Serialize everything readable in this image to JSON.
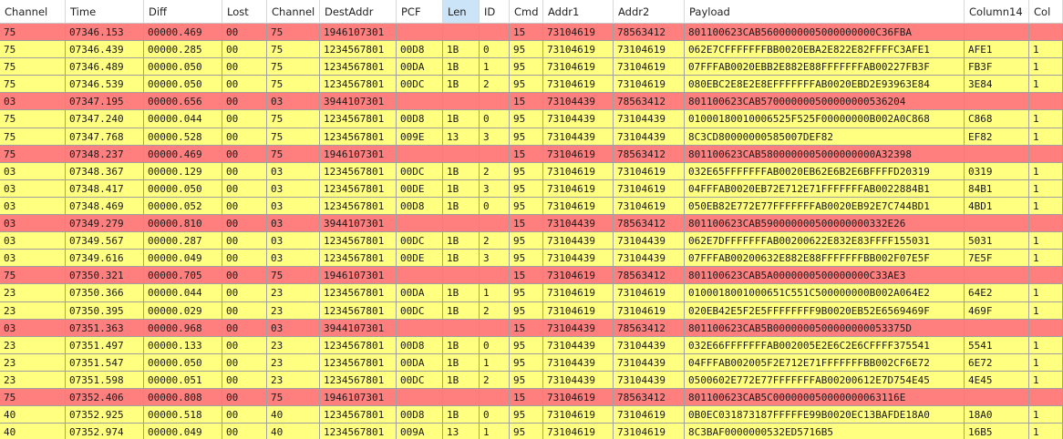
{
  "table": {
    "sorted_column": "Len",
    "columns": [
      "Channel",
      "Time",
      "Diff",
      "Lost",
      "Channel",
      "DestAddr",
      "PCF",
      "Len",
      "ID",
      "Cmd",
      "Addr1",
      "Addr2",
      "Payload",
      "Column14",
      "Col"
    ],
    "rows": [
      {
        "kind": "sep",
        "cells": [
          "75",
          "07346.153",
          "00000.469",
          "00",
          "75",
          "1946107301",
          "",
          "",
          "",
          "15",
          "73104619",
          "78563412",
          "801100623CAB5600000005000000000C36FBA",
          "",
          ""
        ]
      },
      {
        "kind": "msg",
        "cells": [
          "75",
          "07346.439",
          "00000.285",
          "00",
          "75",
          "1234567801",
          "00D8",
          "1B",
          "0",
          "95",
          "73104619",
          "73104619",
          "062E7CFFFFFFFBB0020EBA2E822E82FFFFC3AFE1",
          "AFE1",
          "1"
        ]
      },
      {
        "kind": "msg",
        "cells": [
          "75",
          "07346.489",
          "00000.050",
          "00",
          "75",
          "1234567801",
          "00DA",
          "1B",
          "1",
          "95",
          "73104619",
          "73104619",
          "07FFFAB0020EBB2E882E88FFFFFFFAB00227FB3F",
          "FB3F",
          "1"
        ]
      },
      {
        "kind": "msg",
        "cells": [
          "75",
          "07346.539",
          "00000.050",
          "00",
          "75",
          "1234567801",
          "00DC",
          "1B",
          "2",
          "95",
          "73104619",
          "73104619",
          "080EBC2E8E2E8EFFFFFFFAB0020EBD2E93963E84",
          "3E84",
          "1"
        ]
      },
      {
        "kind": "sep",
        "cells": [
          "03",
          "07347.195",
          "00000.656",
          "00",
          "03",
          "3944107301",
          "",
          "",
          "",
          "15",
          "73104439",
          "78563412",
          "801100623CAB570000000500000000536204",
          "",
          ""
        ]
      },
      {
        "kind": "msg",
        "cells": [
          "75",
          "07347.240",
          "00000.044",
          "00",
          "75",
          "1234567801",
          "00D8",
          "1B",
          "0",
          "95",
          "73104439",
          "73104439",
          "01000180010006525F525F00000000B002A0C868",
          "C868",
          "1"
        ]
      },
      {
        "kind": "msg",
        "cells": [
          "75",
          "07347.768",
          "00000.528",
          "00",
          "75",
          "1234567801",
          "009E",
          "13",
          "3",
          "95",
          "73104439",
          "73104439",
          "8C3CD80000000585007DEF82",
          "EF82",
          "1"
        ]
      },
      {
        "kind": "sep",
        "cells": [
          "75",
          "07348.237",
          "00000.469",
          "00",
          "75",
          "1946107301",
          "",
          "",
          "",
          "15",
          "73104619",
          "78563412",
          "801100623CAB5800000005000000000A32398",
          "",
          ""
        ]
      },
      {
        "kind": "msg",
        "cells": [
          "03",
          "07348.367",
          "00000.129",
          "00",
          "03",
          "1234567801",
          "00DC",
          "1B",
          "2",
          "95",
          "73104619",
          "73104619",
          "032E65FFFFFFFAB0020EB62E6B2E6BFFFFD20319",
          "0319",
          "1"
        ]
      },
      {
        "kind": "msg",
        "cells": [
          "03",
          "07348.417",
          "00000.050",
          "00",
          "03",
          "1234567801",
          "00DE",
          "1B",
          "3",
          "95",
          "73104619",
          "73104619",
          "04FFFAB0020EB72E712E71FFFFFFFAB0022884B1",
          "84B1",
          "1"
        ]
      },
      {
        "kind": "msg",
        "cells": [
          "03",
          "07348.469",
          "00000.052",
          "00",
          "03",
          "1234567801",
          "00D8",
          "1B",
          "0",
          "95",
          "73104619",
          "73104619",
          "050EB82E772E77FFFFFFFAB0020EB92E7C744BD1",
          "4BD1",
          "1"
        ]
      },
      {
        "kind": "sep",
        "cells": [
          "03",
          "07349.279",
          "00000.810",
          "00",
          "03",
          "3944107301",
          "",
          "",
          "",
          "15",
          "73104439",
          "78563412",
          "801100623CAB590000000500000000332E26",
          "",
          ""
        ]
      },
      {
        "kind": "msg",
        "cells": [
          "03",
          "07349.567",
          "00000.287",
          "00",
          "03",
          "1234567801",
          "00DC",
          "1B",
          "2",
          "95",
          "73104439",
          "73104439",
          "062E7DFFFFFFFAB00200622E832E83FFFF155031",
          "5031",
          "1"
        ]
      },
      {
        "kind": "msg",
        "cells": [
          "03",
          "07349.616",
          "00000.049",
          "00",
          "03",
          "1234567801",
          "00DE",
          "1B",
          "3",
          "95",
          "73104439",
          "73104439",
          "07FFFAB00200632E882E88FFFFFFFBB002F07E5F",
          "7E5F",
          "1"
        ]
      },
      {
        "kind": "sep",
        "cells": [
          "75",
          "07350.321",
          "00000.705",
          "00",
          "75",
          "1946107301",
          "",
          "",
          "",
          "15",
          "73104619",
          "78563412",
          "801100623CAB5A0000000500000000C33AE3",
          "",
          ""
        ]
      },
      {
        "kind": "msg",
        "cells": [
          "23",
          "07350.366",
          "00000.044",
          "00",
          "23",
          "1234567801",
          "00DA",
          "1B",
          "1",
          "95",
          "73104619",
          "73104619",
          "0100018001000651C551C500000000B002A064E2",
          "64E2",
          "1"
        ]
      },
      {
        "kind": "msg",
        "cells": [
          "23",
          "07350.395",
          "00000.029",
          "00",
          "23",
          "1234567801",
          "00DC",
          "1B",
          "2",
          "95",
          "73104619",
          "73104619",
          "020EB42E5F2E5FFFFFFFF9B0020EB52E6569469F",
          "469F",
          "1"
        ]
      },
      {
        "kind": "sep",
        "cells": [
          "03",
          "07351.363",
          "00000.968",
          "00",
          "03",
          "3944107301",
          "",
          "",
          "",
          "15",
          "73104439",
          "78563412",
          "801100623CAB5B0000000500000000053375D",
          "",
          ""
        ]
      },
      {
        "kind": "msg",
        "cells": [
          "23",
          "07351.497",
          "00000.133",
          "00",
          "23",
          "1234567801",
          "00D8",
          "1B",
          "0",
          "95",
          "73104439",
          "73104439",
          "032E66FFFFFFFAB002005E2E6C2E6CFFFF375541",
          "5541",
          "1"
        ]
      },
      {
        "kind": "msg",
        "cells": [
          "23",
          "07351.547",
          "00000.050",
          "00",
          "23",
          "1234567801",
          "00DA",
          "1B",
          "1",
          "95",
          "73104439",
          "73104439",
          "04FFFAB002005F2E712E71FFFFFFFBB002CF6E72",
          "6E72",
          "1"
        ]
      },
      {
        "kind": "msg",
        "cells": [
          "23",
          "07351.598",
          "00000.051",
          "00",
          "23",
          "1234567801",
          "00DC",
          "1B",
          "2",
          "95",
          "73104439",
          "73104439",
          "0500602E772E77FFFFFFFAB00200612E7D754E45",
          "4E45",
          "1"
        ]
      },
      {
        "kind": "sep",
        "cells": [
          "75",
          "07352.406",
          "00000.808",
          "00",
          "75",
          "1946107301",
          "",
          "",
          "",
          "15",
          "73104619",
          "78563412",
          "801100623CAB5C000000050000000063116E",
          "",
          ""
        ]
      },
      {
        "kind": "msg",
        "cells": [
          "40",
          "07352.925",
          "00000.518",
          "00",
          "40",
          "1234567801",
          "00D8",
          "1B",
          "0",
          "95",
          "73104619",
          "73104619",
          "0B0EC031873187FFFFFE99B0020EC13BAFDE18A0",
          "18A0",
          "1"
        ]
      },
      {
        "kind": "msg",
        "cells": [
          "40",
          "07352.974",
          "00000.049",
          "00",
          "40",
          "1234567801",
          "009A",
          "13",
          "1",
          "95",
          "73104619",
          "73104619",
          "8C3BAF0000000532ED5716B5",
          "16B5",
          "1"
        ]
      }
    ]
  },
  "colors": {
    "separator_row": "#ff7f7f",
    "message_row": "#ffff80",
    "sorted_header": "#cce4f7"
  }
}
